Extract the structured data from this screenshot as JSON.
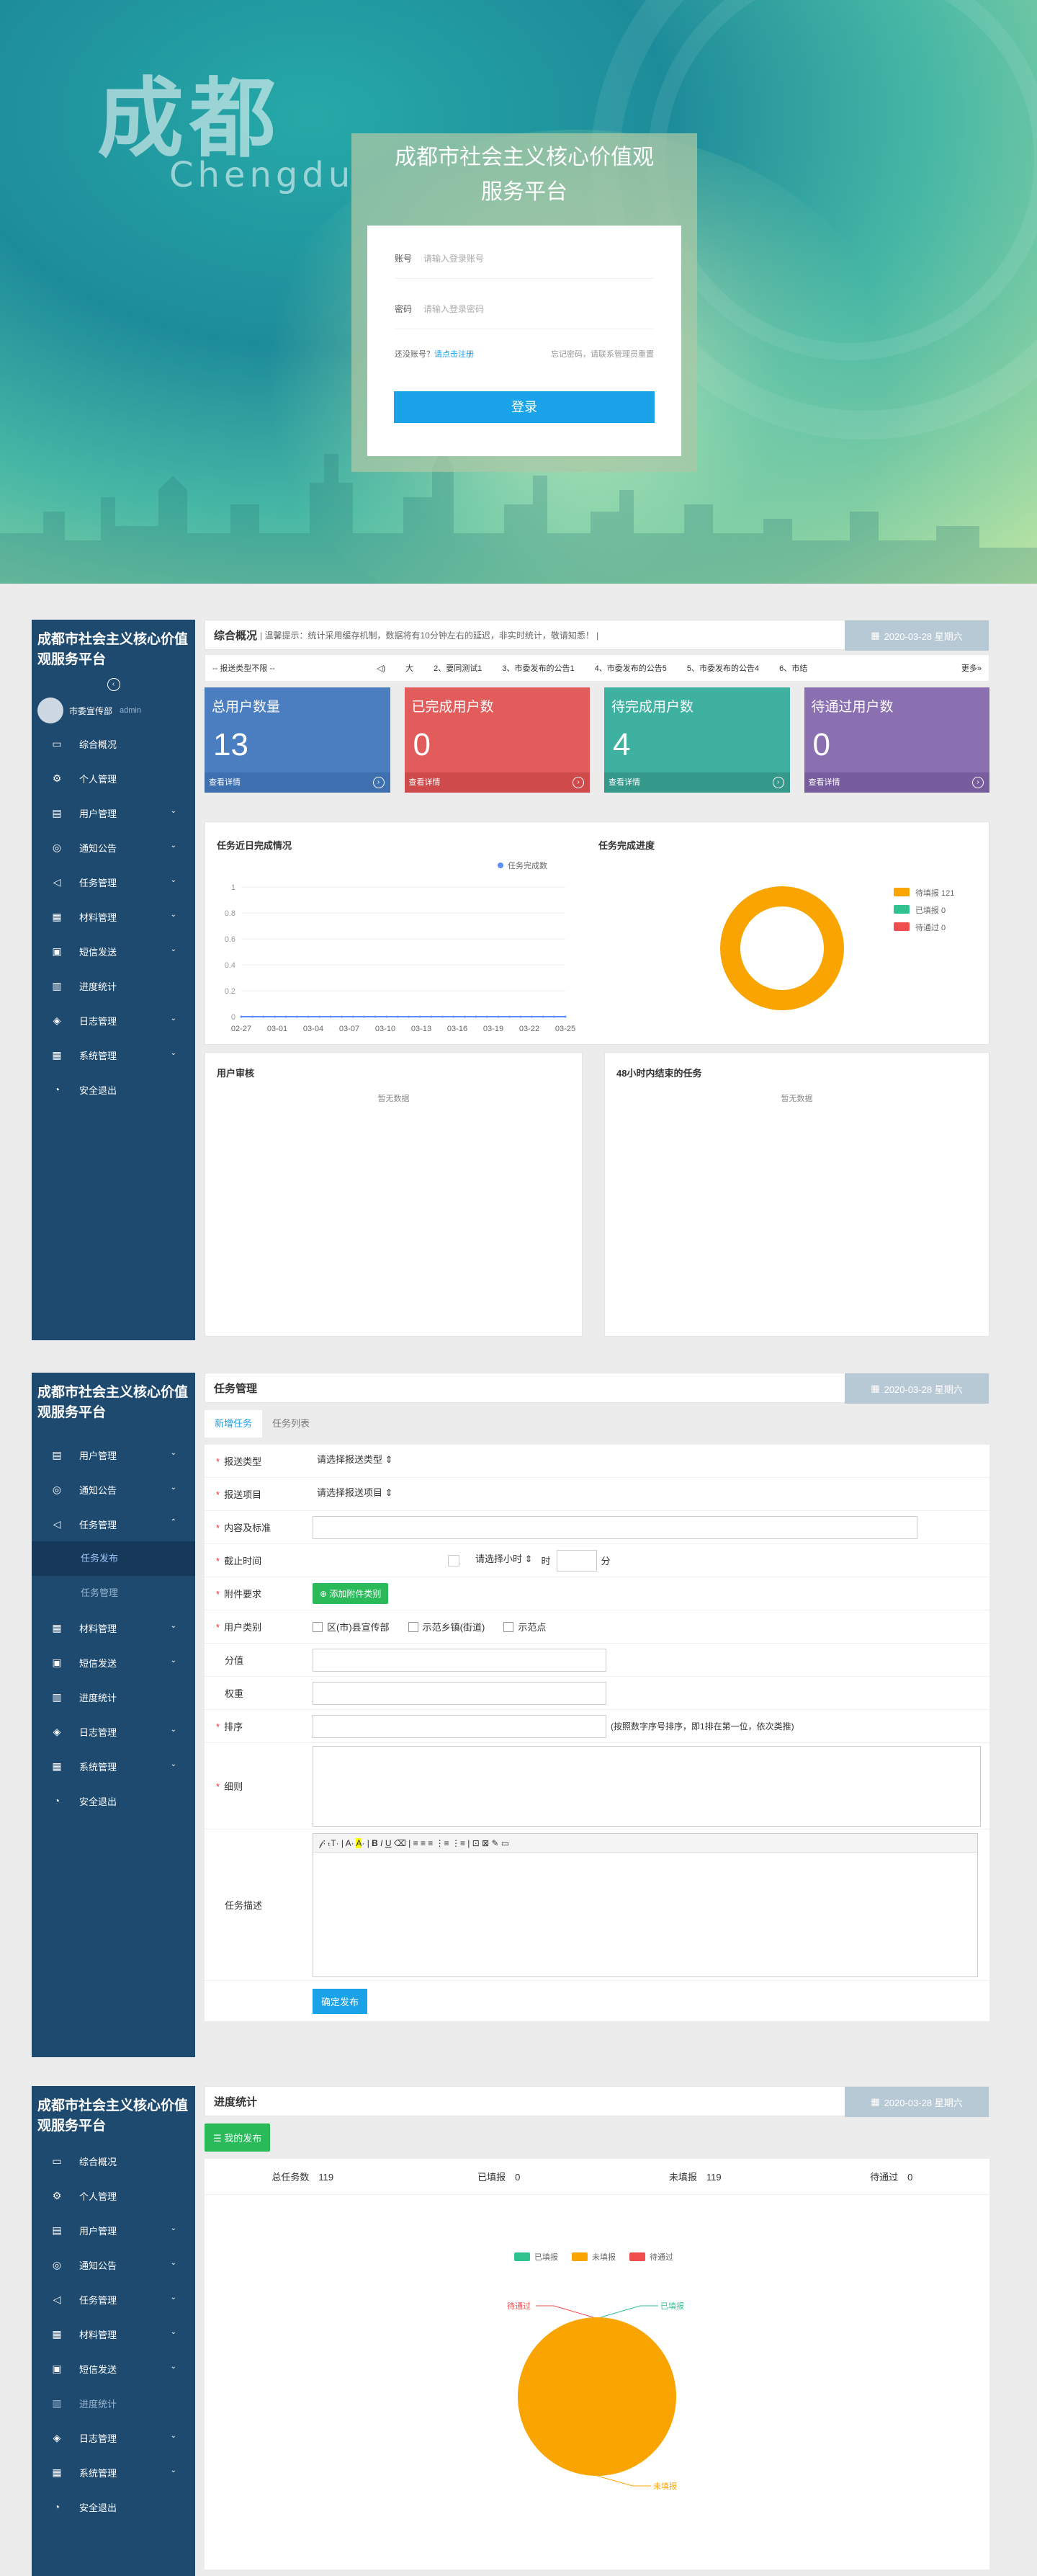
{
  "login": {
    "city_zh": "成都",
    "city_en": "Chengdu",
    "title_line1": "成都市社会主义核心价值观",
    "title_line2": "服务平台",
    "account_label": "账号",
    "account_placeholder": "请输入登录账号",
    "password_label": "密码",
    "password_placeholder": "请输入登录密码",
    "no_account": "还没账号？",
    "register_link": "请点击注册",
    "forgot_text": "忘记密码，请联系管理员重置",
    "login_button": "登录"
  },
  "sidebar": {
    "brand": "成都市社会主义核心价值观服务平台",
    "user_name": "市委宣传部",
    "user_role": "admin",
    "items": [
      "综合概况",
      "个人管理",
      "用户管理",
      "通知公告",
      "任务管理",
      "材料管理",
      "短信发送",
      "进度统计",
      "日志管理",
      "系统管理",
      "安全退出"
    ],
    "sub_items": [
      "任务发布",
      "任务管理"
    ]
  },
  "overview": {
    "header": "综合概况",
    "tip": "| 温馨提示：统计采用缓存机制，数据将有10分钟左右的延迟，非实时统计，敬请知悉！ |",
    "date": "2020-03-28 星期六",
    "filter": "-- 报送类型不限 --",
    "notices": [
      "大",
      "2、要同测试1",
      "3、市委发布的公告1",
      "4、市委发布的公告5",
      "5、市委发布的公告4",
      "6、市结"
    ],
    "more": "更多»",
    "cards": [
      {
        "title": "总用户数量",
        "value": "13",
        "link": "查看详情",
        "color": "#4a7ec0"
      },
      {
        "title": "已完成用户数",
        "value": "0",
        "link": "查看详情",
        "color": "#e35c5c"
      },
      {
        "title": "待完成用户数",
        "value": "4",
        "link": "查看详情",
        "color": "#3fb1a1"
      },
      {
        "title": "待通过用户数",
        "value": "0",
        "link": "查看详情",
        "color": "#8a6fb1"
      }
    ],
    "line_chart_title": "任务近日完成情况",
    "donut_title": "任务完成进度",
    "user_audit_title": "用户审核",
    "no_data": "暂无数据",
    "deadline_title": "48小时内结束的任务"
  },
  "chart_data": [
    {
      "type": "line",
      "title": "任务近日完成情况",
      "series": [
        {
          "name": "任务完成数",
          "values": [
            0,
            0,
            0,
            0,
            0,
            0,
            0,
            0,
            0,
            0,
            0,
            0,
            0,
            0,
            0,
            0,
            0,
            0,
            0,
            0,
            0,
            0,
            0,
            0,
            0,
            0,
            0,
            0,
            0,
            0
          ]
        }
      ],
      "x_ticks": [
        "02-27",
        "03-01",
        "03-04",
        "03-07",
        "03-10",
        "03-13",
        "03-16",
        "03-19",
        "03-22",
        "03-25"
      ],
      "y_ticks": [
        "0",
        "0.2",
        "0.4",
        "0.6",
        "0.8",
        "1"
      ],
      "ylim": [
        0,
        1
      ],
      "color": "#5b8ff9"
    },
    {
      "type": "pie",
      "title": "任务完成进度",
      "labels": [
        "待填报",
        "已填报",
        "待通过"
      ],
      "values": [
        121,
        0,
        0
      ],
      "colors": [
        "#f9a400",
        "#2fc28f",
        "#f04e4e"
      ]
    },
    {
      "type": "pie",
      "labels": [
        "已填报",
        "未填报",
        "待通过"
      ],
      "values": [
        0,
        119,
        0
      ],
      "colors": [
        "#2fc28f",
        "#f9a400",
        "#f04e4e"
      ]
    }
  ],
  "task": {
    "header": "任务管理",
    "date": "2020-03-28 星期六",
    "tab_new": "新增任务",
    "tab_list": "任务列表",
    "label_type": "报送类型",
    "type_select": "请选择报送类型",
    "label_project": "报送项目",
    "project_select": "请选择报送项目",
    "label_content": "内容及标准",
    "label_deadline": "截止时间",
    "hour_select": "请选择小时",
    "unit_hour": "时",
    "unit_min": "分",
    "label_attachment": "附件要求",
    "add_attachment": "添加附件类别",
    "label_usertype": "用户类别",
    "usertypes": [
      "区(市)县宣传部",
      "示范乡镇(街道)",
      "示范点"
    ],
    "label_score": "分值",
    "label_weight": "权重",
    "label_order": "排序",
    "order_hint": "(按照数字序号排序，即1排在第一位，依次类推)",
    "label_rules": "细则",
    "label_desc": "任务描述",
    "submit": "确定发布"
  },
  "progress": {
    "header": "进度统计",
    "date": "2020-03-28 星期六",
    "my_publish": "我的发布",
    "total_label": "总任务数",
    "total": "119",
    "filled_label": "已填报",
    "filled": "0",
    "unfilled_label": "未填报",
    "unfilled": "119",
    "pending_label": "待通过",
    "pending": "0",
    "pie_labels": [
      "待通过",
      "已填报",
      "未填报"
    ],
    "legend": [
      "已填报",
      "未填报",
      "待通过"
    ]
  }
}
